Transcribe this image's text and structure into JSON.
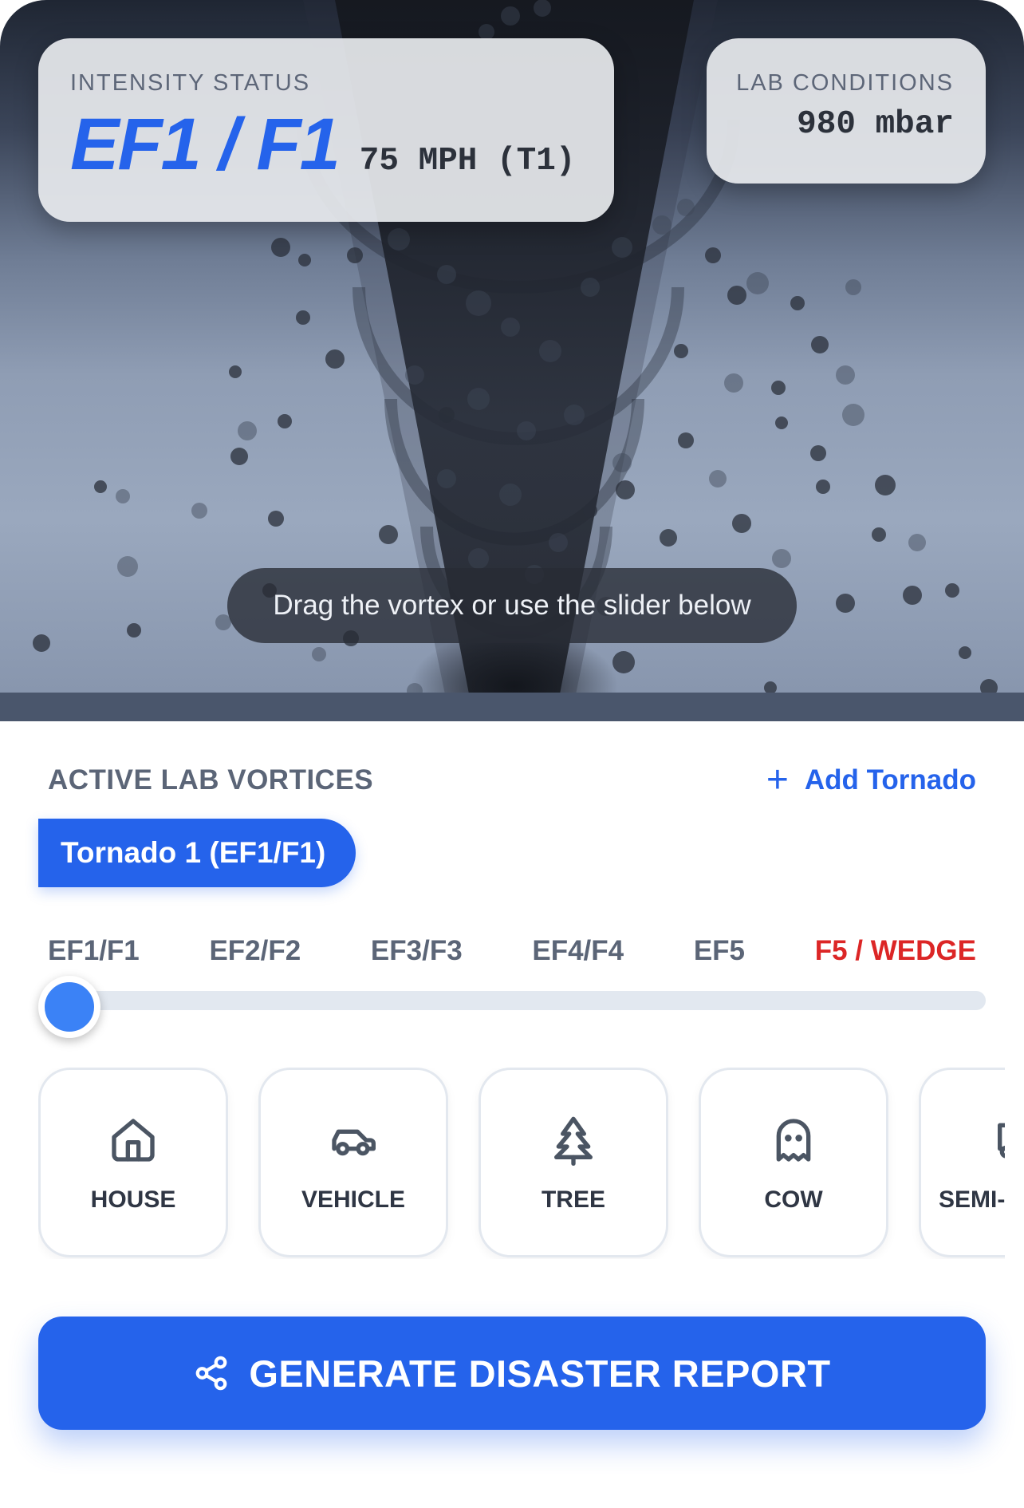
{
  "status": {
    "label": "INTENSITY STATUS",
    "value": "EF1 / F1",
    "speed": "75 MPH (T1)"
  },
  "lab": {
    "label": "LAB CONDITIONS",
    "pressure": "980 mbar"
  },
  "scene": {
    "hint": "Drag the vortex or use the slider below"
  },
  "vortices": {
    "title": "ACTIVE LAB VORTICES",
    "add_label": "Add Tornado",
    "items": [
      {
        "label": "Tornado 1 (EF1/F1)",
        "active": true
      }
    ]
  },
  "intensity_slider": {
    "levels": [
      "EF1/F1",
      "EF2/F2",
      "EF3/F3",
      "EF4/F4",
      "EF5",
      "F5 / WEDGE"
    ],
    "value_index": 0,
    "value_fraction": 0.0
  },
  "objects": [
    {
      "label": "HOUSE",
      "icon": "house-icon"
    },
    {
      "label": "VEHICLE",
      "icon": "car-icon"
    },
    {
      "label": "TREE",
      "icon": "tree-icon"
    },
    {
      "label": "COW",
      "icon": "ghost-icon"
    },
    {
      "label": "SEMI-",
      "icon": "truck-icon"
    }
  ],
  "report": {
    "label": "GENERATE DISASTER REPORT",
    "icon": "share-icon"
  },
  "colors": {
    "accent": "#2563eb",
    "danger": "#dc2626",
    "muted": "#5b6577"
  }
}
